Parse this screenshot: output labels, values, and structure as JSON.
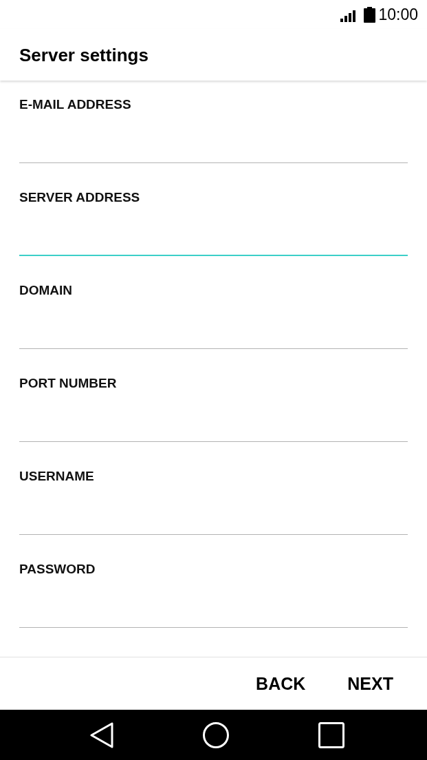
{
  "status_bar": {
    "time": "10:00"
  },
  "header": {
    "title": "Server settings"
  },
  "fields": [
    {
      "label": "E-MAIL ADDRESS",
      "focused": false
    },
    {
      "label": "SERVER ADDRESS",
      "focused": true
    },
    {
      "label": "DOMAIN",
      "focused": false
    },
    {
      "label": "PORT NUMBER",
      "focused": false
    },
    {
      "label": "USERNAME",
      "focused": false
    },
    {
      "label": "PASSWORD",
      "focused": false
    }
  ],
  "buttons": [
    "BACK",
    "NEXT"
  ]
}
